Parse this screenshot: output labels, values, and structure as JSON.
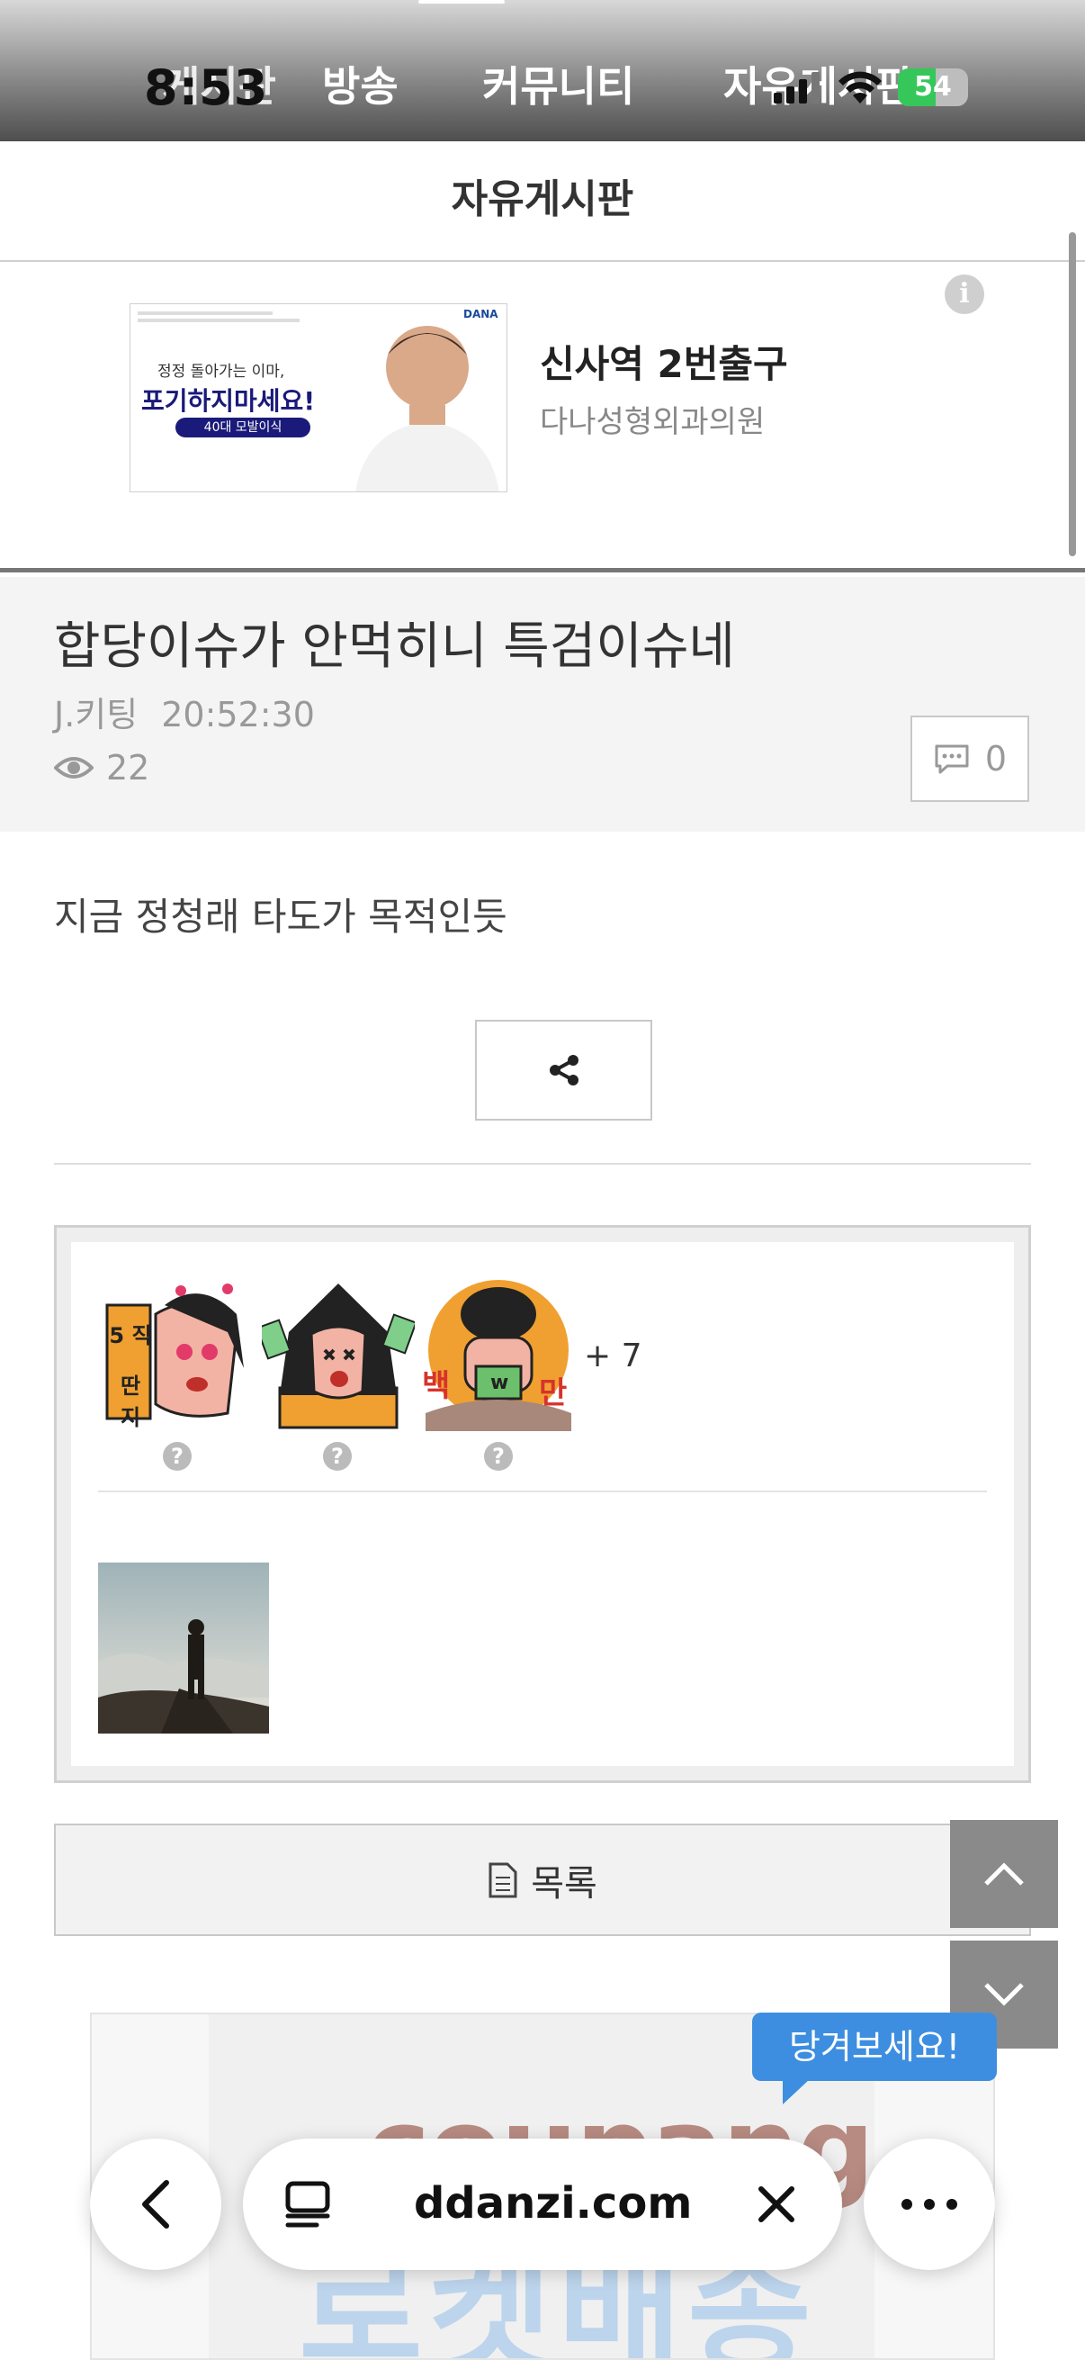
{
  "status_bar": {
    "time": "8:53",
    "battery": "54",
    "battery_level": 0.54
  },
  "top_nav": {
    "tabs": [
      "게시판",
      "방송",
      "커뮤니티",
      "자유게시판"
    ]
  },
  "board": {
    "title": "자유게시판"
  },
  "ad": {
    "image_text_small": "정정 돌아가는 이마,",
    "image_text_big": "포기하지마세요!",
    "image_tag": "40대 모발이식",
    "image_brand": "DANA",
    "title": "신사역 2번출구",
    "advertiser": "다나성형외과의원"
  },
  "post": {
    "title": "합당이슈가 안먹히니 특검이슈네",
    "author": "J.키팅",
    "time": "20:52:30",
    "views": "22",
    "comments": "0",
    "body": "지금 정청래 타도가 목적인듯"
  },
  "reactions": {
    "stickers": [
      {
        "name": "5직딴지",
        "label_top": "5 직",
        "label_bottom": "딴 지"
      },
      {
        "name": "money",
        "label_top": "",
        "label_bottom": ""
      },
      {
        "name": "백만",
        "label_left": "백",
        "label_right": "만",
        "label_center": "w"
      }
    ],
    "more_count": "+ 7"
  },
  "list_button": {
    "label": "목록"
  },
  "bottom_ad": {
    "logo": "coupang",
    "big_text": "로켓배송",
    "bubble": "당겨보세요!"
  },
  "browser": {
    "url": "ddanzi.com"
  },
  "colors": {
    "accent_blue": "#3d8ee0",
    "battery_green": "#35c759",
    "nav_gray": "#4e4e4e"
  }
}
